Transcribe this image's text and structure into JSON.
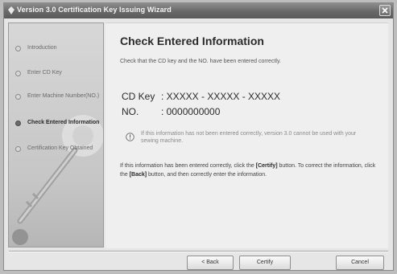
{
  "window": {
    "title": "Version 3.0 Certification Key Issuing Wizard"
  },
  "sidebar": {
    "steps": [
      {
        "label": "Introduction",
        "active": false
      },
      {
        "label": "Enter CD Key",
        "active": false
      },
      {
        "label": "Enter Machine Number(NO.)",
        "active": false
      },
      {
        "label": "Check Entered Information",
        "active": true
      },
      {
        "label": "Certification Key Obtained",
        "active": false
      }
    ]
  },
  "main": {
    "heading": "Check Entered Information",
    "instruction": "Check that the CD key and the NO. have been entered correctly.",
    "cd_key_label": "CD Key",
    "cd_key_value": ": XXXXX - XXXXX - XXXXX",
    "no_label": "NO.",
    "no_value": ": 0000000000",
    "warning": "If this information has not been entered correctly, version 3.0 cannot be used with your sewing machine.",
    "note_1": "If this information has been entered correctly, click the ",
    "note_certify": "[Certify]",
    "note_2": " button. To correct the information, click the ",
    "note_back": "[Back]",
    "note_3": " button, and then correctly enter the information."
  },
  "buttons": {
    "back": "< Back",
    "certify": "Certify",
    "cancel": "Cancel"
  },
  "icons": {
    "app": "app-icon",
    "close": "close-icon",
    "info": "info-icon"
  }
}
